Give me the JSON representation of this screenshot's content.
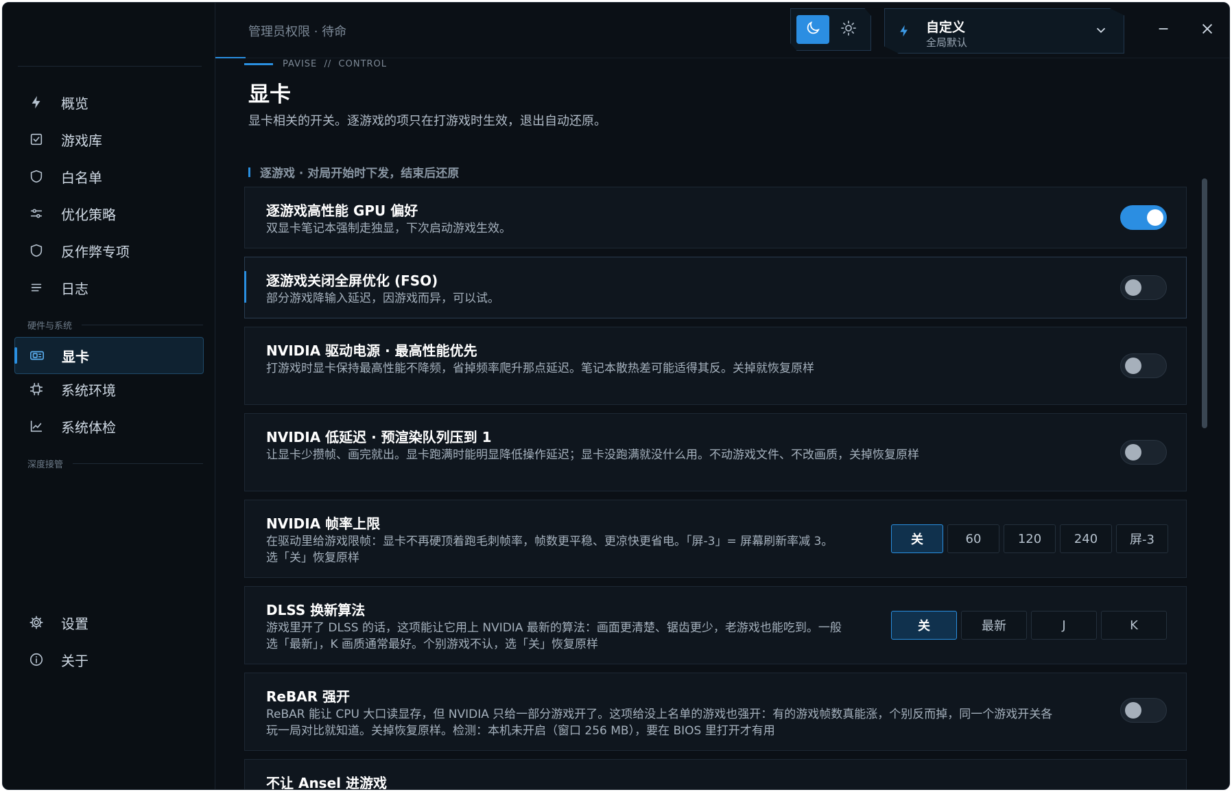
{
  "header": {
    "admin_status": "管理员权限 · 待命",
    "theme": {
      "dark_icon": "moon-icon",
      "light_icon": "sun-icon",
      "selected": "dark"
    },
    "profile": {
      "title": "自定义",
      "subtitle": "全局默认",
      "icon": "bolt-icon"
    }
  },
  "sidebar": {
    "items": [
      {
        "label": "概览",
        "icon": "bolt-icon"
      },
      {
        "label": "游戏库",
        "icon": "checkbox-icon"
      },
      {
        "label": "白名单",
        "icon": "shield-icon"
      },
      {
        "label": "优化策略",
        "icon": "sliders-icon"
      },
      {
        "label": "反作弊专项",
        "icon": "shield-icon"
      },
      {
        "label": "日志",
        "icon": "list-icon"
      }
    ],
    "group_hardware": "硬件与系统",
    "hardware_items": [
      {
        "label": "显卡",
        "icon": "gpu-icon",
        "active": true
      },
      {
        "label": "系统环境",
        "icon": "chip-icon"
      },
      {
        "label": "系统体检",
        "icon": "chart-icon"
      }
    ],
    "group_deep": "深度接管",
    "bottom_items": [
      {
        "label": "设置",
        "icon": "gear-icon"
      },
      {
        "label": "关于",
        "icon": "info-icon"
      }
    ]
  },
  "main": {
    "breadcrumb": "PAVISE  //  CONTROL",
    "title": "显卡",
    "description": "显卡相关的开关。逐游戏的项只在打游戏时生效，退出自动还原。",
    "section": "逐游戏 · 对局开始时下发，结束后还原",
    "cards": [
      {
        "title": "逐游戏高性能 GPU 偏好",
        "desc": "双显卡笔记本强制走独显，下次启动游戏生效。",
        "enabled": true
      },
      {
        "title": "逐游戏关闭全屏优化 (FSO)",
        "desc": "部分游戏降输入延迟，因游戏而异，可以试。",
        "enabled": false
      },
      {
        "title": "NVIDIA 驱动电源 · 最高性能优先",
        "desc": "打游戏时显卡保持最高性能不降频，省掉频率爬升那点延迟。笔记本散热差可能适得其反。关掉就恢复原样",
        "enabled": false
      },
      {
        "title": "NVIDIA 低延迟 · 预渲染队列压到 1",
        "desc": "让显卡少攒帧、画完就出。显卡跑满时能明显降低操作延迟；显卡没跑满就没什么用。不动游戏文件、不改画质，关掉恢复原样",
        "enabled": false
      },
      {
        "title": "NVIDIA 帧率上限",
        "desc1": "在驱动里给游戏限帧：显卡不再硬顶着跑毛刺帧率，帧数更平稳、更凉快更省电。「屏-3」= 屏幕刷新率减 3。",
        "desc2": "选「关」恢复原样",
        "options": [
          "关",
          "60",
          "120",
          "240",
          "屏-3"
        ],
        "selected": "关"
      },
      {
        "title": "DLSS 换新算法",
        "desc1": "游戏里开了 DLSS 的话，这项能让它用上 NVIDIA 最新的算法：画面更清楚、锯齿更少，老游戏也能吃到。一般",
        "desc2": "选「最新」，K 画质通常最好。个别游戏不认，选「关」恢复原样",
        "options": [
          "关",
          "最新",
          "J",
          "K"
        ],
        "selected": "关"
      },
      {
        "title": "ReBAR 强开",
        "desc1": "ReBAR 能让 CPU 大口读显存，但 NVIDIA 只给一部分游戏开了。这项给没上名单的游戏也强开：有的游戏帧数真能涨，个别反而掉，同一个游戏开关各",
        "desc2": "玩一局对比就知道。关掉恢复原样。检测：本机未开启（窗口 256 MB），要在 BIOS 里打开才有用",
        "enabled": false
      },
      {
        "title": "不让 Ansel 进游戏"
      }
    ]
  }
}
